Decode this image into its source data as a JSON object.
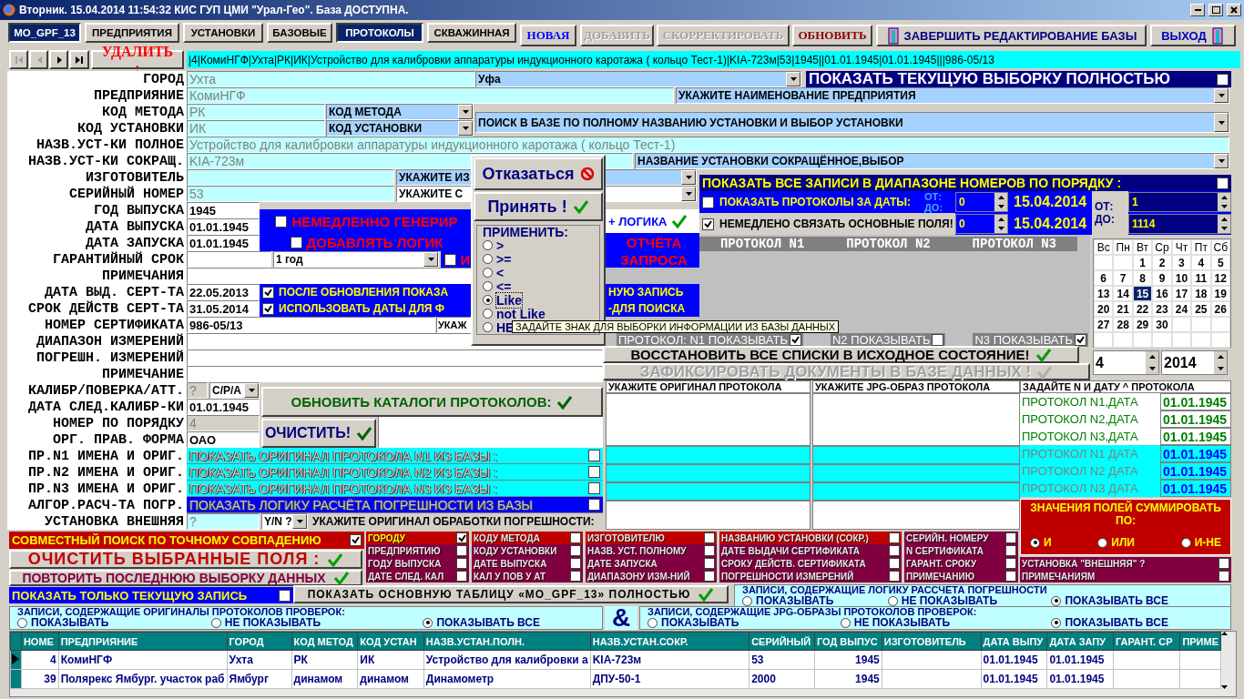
{
  "window": {
    "title": "Вторник. 15.04.2014 11:54:32  КИС ГУП ЦМИ \"Урал-Гео\". База ДОСТУПНА."
  },
  "tabs": [
    {
      "label": "MO_GPF_13",
      "selected": true
    },
    {
      "label": "ПРЕДПРИЯТИЯ",
      "selected": false
    },
    {
      "label": "УСТАНОВКИ",
      "selected": false
    },
    {
      "label": "БАЗОВЫЕ",
      "selected": false
    },
    {
      "label": "ПРОТОКОЛЫ",
      "selected": true
    },
    {
      "label": "СКВАЖИННАЯ",
      "selected": false
    }
  ],
  "toolbar": [
    {
      "kind": "serif",
      "label": "НОВАЯ",
      "disabled": false,
      "color": "#0000ff"
    },
    {
      "kind": "serif",
      "label": "ДОБАВИТЬ",
      "disabled": true
    },
    {
      "kind": "serif",
      "label": "СКОРРЕКТИРОВАТЬ",
      "disabled": true
    },
    {
      "kind": "serif",
      "label": "ОБНОВИТЬ",
      "disabled": false,
      "color": "#8b0000"
    },
    {
      "kind": "door",
      "label": "ЗАВЕРШИТЬ РЕДАКТИРОВАНИЕ БАЗЫ",
      "disabled": false,
      "color": "#000080"
    },
    {
      "kind": "door",
      "label": "ВЫХОД",
      "disabled": false,
      "color": "#0000c0"
    }
  ],
  "nav": {
    "buttons": [
      {
        "kind": "first",
        "disabled": true
      },
      {
        "kind": "prev",
        "disabled": true
      },
      {
        "kind": "next",
        "disabled": false
      },
      {
        "kind": "last",
        "disabled": false
      }
    ],
    "delete_label": "УДАЛИТЬ :",
    "record": "|4|КомиНГФ|Ухта|РК|ИК|Устройство для калибровки аппаратуры индукционного каротажа ( кольцо Тест-1)|KIA-723м|53|1945||01.01.1945|01.01.1945|||986-05/13"
  },
  "labels": [
    "ГОРОД",
    "ПРЕДПРИЯНИЕ",
    "КОД МЕТОДА",
    "КОД УСТАНОВКИ",
    "НАЗВ.УСТ-КИ ПОЛНОЕ",
    "НАЗВ.УСТ-КИ СОКРАЩ.",
    "ИЗГОТОВИТЕЛЬ",
    "СЕРИЙНЫЙ НОМЕР",
    "ГОД ВЫПУСКА",
    "ДАТА ВЫПУСКА",
    "ДАТА ЗАПУСКА",
    "ГАРАНТИЙНЫЙ СРОК",
    "ПРИМЕЧАНИЯ",
    "ДАТА ВЫД. СЕРТ-ТА",
    "СРОК ДЕЙСТВ СЕРТ-ТА",
    "НОМЕР СЕРТИФИКАТА",
    "ДИАПАЗОН ИЗМЕРЕНИЙ",
    "ПОГРЕШН. ИЗМЕРЕНИЙ",
    "ПРИМЕЧАНИЕ",
    "КАЛИБР/ПОВЕРКА/АТТ.",
    "ДАТА СЛЕД.КАЛИБР-КИ",
    "НОМЕР ПО ПОРЯДКУ",
    "ОРГ. ПРАВ. ФОРМА",
    "ПР.N1 ИМЕНА И ОРИГ.",
    "ПР.N2 ИМЕНА И ОРИГ.",
    "ПР.N3 ИМЕНА И ОРИГ.",
    "АЛГОР.РАСЧ-ТА ПОГР.",
    "УСТАНОВКА ВНЕШНЯЯ"
  ],
  "fields": [
    {
      "kind": "field",
      "value": "Ухта",
      "color": "#c0ffff",
      "disabled": true
    },
    {
      "kind": "combo",
      "value": "Уфа",
      "color": "#a6d2ff"
    },
    {
      "kind": "field",
      "value": "КомиНГФ",
      "color": "#c0ffff",
      "disabled": true
    },
    {
      "kind": "combo",
      "value": "УКАЖИТЕ НАИМЕНОВАНИЕ ПРЕДПРИЯТИЯ",
      "color": "#a6d2ff"
    },
    {
      "kind": "field",
      "value": "РК",
      "color": "#c0ffff",
      "disabled": true
    },
    {
      "kind": "combo",
      "value": "КОД МЕТОДА",
      "color": "#a6d2ff"
    },
    {
      "kind": "field",
      "value": "ИК",
      "color": "#c0ffff",
      "disabled": true
    },
    {
      "kind": "combo",
      "value": "КОД УСТАНОВКИ",
      "color": "#a6d2ff"
    },
    {
      "kind": "combo",
      "value": "ПОИСК В БАЗЕ ПО ПОЛНОМУ НАЗВАНИЮ УСТАНОВКИ И ВЫБОР УСТАНОВКИ",
      "color": "#a6d2ff"
    },
    {
      "kind": "field",
      "value": "Устройство для калибровки аппаратуры индукционного каротажа ( кольцо Тест-1)",
      "color": "#c0ffff",
      "disabled": true
    },
    {
      "kind": "field",
      "value": "KIA-723м",
      "color": "#c0ffff",
      "disabled": true
    },
    {
      "kind": "combo",
      "value": "НАЗВАНИЕ УСТАНОВКИ СОКРАЩЁННОЕ,ВЫБОР",
      "color": "#a6d2ff"
    },
    {
      "kind": "field",
      "color": "#c0ffff"
    },
    {
      "kind": "combo",
      "value": "УКАЖИТЕ ИЗ",
      "color": "#a6d2ff"
    },
    {
      "kind": "field",
      "value": "53",
      "color": "#c0ffff",
      "disabled": true
    },
    {
      "kind": "combo",
      "value": "УКАЖИТЕ С",
      "color": "#ffffff"
    },
    {
      "kind": "field",
      "value": "1945",
      "color": "#ffffff"
    },
    {
      "kind": "field",
      "value": "01.01.1945",
      "color": "#ffffff"
    },
    {
      "kind": "field",
      "value": "01.01.1945",
      "color": "#ffffff"
    },
    {
      "kind": "field",
      "color": "#ffffff"
    },
    {
      "kind": "combo",
      "value": "1 год",
      "color": "#ffffff"
    },
    {
      "kind": "field",
      "color": "#ffffff"
    },
    {
      "kind": "field",
      "value": "22.05.2013",
      "color": "#ffffff"
    },
    {
      "kind": "field",
      "value": "31.05.2014",
      "color": "#ffffff"
    },
    {
      "kind": "field",
      "value": "986-05/13",
      "color": "#ffffff"
    },
    {
      "kind": "field",
      "value": "УКАЖ",
      "color": "#ffffff"
    },
    {
      "kind": "field",
      "color": "#ffffff"
    },
    {
      "kind": "field",
      "color": "#ffffff"
    },
    {
      "kind": "field",
      "color": "#ffffff"
    },
    {
      "kind": "field",
      "value": "?",
      "color": "#d4d0c8",
      "disabled": true
    },
    {
      "kind": "combo",
      "value": "C/P/A",
      "color": "#ffffff"
    },
    {
      "kind": "field",
      "value": "01.01.1945",
      "color": "#ffffff"
    },
    {
      "kind": "field",
      "value": "4",
      "color": "#d4d0c8",
      "disabled": true
    },
    {
      "kind": "field",
      "value": "ОАО",
      "color": "#ffffff"
    },
    {
      "kind": "field",
      "value": "?",
      "color": "#c0ffff",
      "disabled": true
    },
    {
      "kind": "combo",
      "value": "Y/N ?",
      "color": "#ffffff"
    },
    {
      "kind": "field",
      "color": "#ffffff"
    }
  ],
  "notices": [
    {
      "kind": "alert",
      "text": "НЕМЕДЛЕННО ГЕНЕРИР",
      "checked": false
    },
    {
      "kind": "alert",
      "text": "ДОБАВЛЯТЬ ЛОГИК",
      "checked": false
    },
    {
      "kind": "alert",
      "text": "И",
      "checked": false
    },
    {
      "kind": "link",
      "text": "+ ЛОГИКА"
    },
    {
      "kind": "alert",
      "text": "ОТЧЁТА"
    },
    {
      "kind": "alert",
      "text": "ЗАПРОСА"
    },
    {
      "kind": "option",
      "text": "ПОСЛЕ ОБНОВЛЕНИЯ ПОКАЗА",
      "checked": true
    },
    {
      "kind": "option",
      "text": "ИСПОЛЬЗОВАТЬ ДАТЫ ДЛЯ Ф",
      "checked": true
    },
    {
      "kind": "option",
      "text": "НУЮ ЗАПИСЬ"
    },
    {
      "kind": "option",
      "text": "-ДЛЯ ПОИСКА"
    }
  ],
  "bars": [
    {
      "kind": "headline",
      "text": "ПОКАЗАТЬ ТЕКУЩУЮ ВЫБОРКУ ПОЛНОСТЬЮ",
      "color": "#000080",
      "checked": false
    },
    {
      "kind": "banner",
      "text": "ПОКАЗАТЬ ВСЕ ЗАПИСИ В ДИАПАЗОНЕ НОМЕРОВ ПО ПОРЯДКУ :",
      "color": "#000080",
      "checked": false
    },
    {
      "kind": "outline",
      "text": "ПОКАЗАТЬ ОРИГИНАЛ ПРОТОКОЛА N1 ИЗ БАЗЫ :",
      "color": "#00ffff",
      "checked": false
    },
    {
      "kind": "outline",
      "text": "ПОКАЗАТЬ ОРИГИНАЛ ПРОТОКОЛА N2 ИЗ БАЗЫ :",
      "color": "#00ffff",
      "checked": false
    },
    {
      "kind": "outline",
      "text": "ПОКАЗАТЬ ОРИГИНАЛ ПРОТОКОЛА N3 ИЗ БАЗЫ :",
      "color": "#00ffff",
      "checked": false
    },
    {
      "kind": "outline",
      "text": "ПОКАЗАТЬ ЛОГИКУ РАСЧЁТА ПОГРЕШНОСТИ ИЗ БАЗЫ",
      "color": "#0000ff",
      "checked": false
    }
  ],
  "date_filter": {
    "by_dates": {
      "label": "ПОКАЗАТЬ ПРОТОКОЛЫ ЗА ДАТЫ:",
      "checked": false
    },
    "link_fields": {
      "label": "НЕМЕДЛЕНО СВЯЗАТЬ ОСНОВНЫЕ ПОЛЯ!",
      "checked": true
    },
    "from_label": "ОТ:",
    "to_label": "ДО:",
    "from_number": "0",
    "to_number": "0",
    "from_date": "15.04.2014",
    "to_date": "15.04.2014",
    "range_from_label": "ОТ:",
    "range_to_label": "ДО:",
    "range_from": "1",
    "range_to": "1114"
  },
  "protocol_headers": [
    "ПРОТОКОЛ N1",
    "ПРОТОКОЛ N2",
    "ПРОТОКОЛ N3"
  ],
  "protocol_toggles": [
    {
      "label": "ПРОТОКОЛ: N1 ПОКАЗЫВАТЬ",
      "checked": true
    },
    {
      "label": "N2 ПОКАЗЫВАТЬ",
      "checked": false
    },
    {
      "label": "N3 ПОКАЗЫВАТЬ",
      "checked": true
    }
  ],
  "actions": [
    {
      "label": "ВОССТАНОВИТЬ ВСЕ СПИСКИ В ИСХОДНОЕ СОСТОЯНИЕ!",
      "disabled": false
    },
    {
      "label": "ЗАФИКСИРОВАТЬ ДОКУМЕНТЫ В БАЗЕ ДАННЫХ !",
      "disabled": true
    },
    {
      "label": "ОБНОВИТЬ КАТАЛОГИ ПРОТОКОЛОВ:",
      "disabled": false
    },
    {
      "label": "ОЧИСТИТЬ!",
      "disabled": false
    }
  ],
  "calendar": {
    "weekdays": [
      "Вс",
      "Пн",
      "Вт",
      "Ср",
      "Чт",
      "Пт",
      "Сб"
    ],
    "weeks": [
      [
        {
          "day": "1",
          "selected": false
        },
        {
          "day": "2",
          "selected": false
        },
        {
          "day": "3",
          "selected": false
        },
        {
          "day": "4",
          "selected": false
        },
        {
          "day": "5",
          "selected": false
        }
      ],
      [
        {
          "day": "6",
          "selected": false
        },
        {
          "day": "7",
          "selected": false
        },
        {
          "day": "8",
          "selected": false
        },
        {
          "day": "9",
          "selected": false
        },
        {
          "day": "10",
          "selected": false
        },
        {
          "day": "11",
          "selected": false
        },
        {
          "day": "12",
          "selected": false
        }
      ],
      [
        {
          "day": "13",
          "selected": false
        },
        {
          "day": "14",
          "selected": false
        },
        {
          "day": "15",
          "selected": true
        },
        {
          "day": "16",
          "selected": false
        },
        {
          "day": "17",
          "selected": false
        },
        {
          "day": "18",
          "selected": false
        },
        {
          "day": "19",
          "selected": false
        }
      ],
      [
        {
          "day": "20",
          "selected": false
        },
        {
          "day": "21",
          "selected": false
        },
        {
          "day": "22",
          "selected": false
        },
        {
          "day": "23",
          "selected": false
        },
        {
          "day": "24",
          "selected": false
        },
        {
          "day": "25",
          "selected": false
        },
        {
          "day": "26",
          "selected": false
        }
      ],
      [
        {
          "day": "27",
          "selected": false
        },
        {
          "day": "28",
          "selected": false
        },
        {
          "day": "29",
          "selected": false
        },
        {
          "day": "30",
          "selected": false
        }
      ]
    ],
    "month": "4",
    "year": "2014"
  },
  "file_columns": [
    {
      "header": "УКАЖИТЕ ОРИГИНАЛ ПРОТОКОЛА"
    },
    {
      "header": "УКАЖИТЕ JPG-ОБРАЗ ПРОТОКОЛА"
    }
  ],
  "protocol_dates": {
    "header": "ЗАДАЙТЕ N И ДАТУ ^ ПРОТОКОЛА",
    "rows": [
      {
        "kind": "edit",
        "label": "ПРОТОКОЛ N1,ДАТА",
        "date": "01.01.1945"
      },
      {
        "kind": "edit",
        "label": "ПРОТОКОЛ N2,ДАТА",
        "date": "01.01.1945"
      },
      {
        "kind": "edit",
        "label": "ПРОТОКОЛ N3,ДАТА",
        "date": "01.01.1945"
      },
      {
        "kind": "view",
        "label": "ПРОТОКОЛ N1 ДАТА",
        "date": "01.01.1945"
      },
      {
        "kind": "view",
        "label": "ПРОТОКОЛ N2 ДАТА",
        "date": "01.01.1945"
      },
      {
        "kind": "view",
        "label": "ПРОТОКОЛ N3 ДАТА",
        "date": "01.01.1945"
      }
    ]
  },
  "error_source_label": "УКАЖИТЕ ОРИГИНАЛ ОБРАБОТКИ ПОГРЕШНОСТИ:",
  "sum_panel": {
    "title": "ЗНАЧЕНИЯ ПОЛЕЙ СУММИРОВАТЬ ПО:",
    "options": [
      {
        "label": "И",
        "selected": true
      },
      {
        "label": "ИЛИ",
        "selected": false
      },
      {
        "label": "И-НЕ",
        "selected": false
      }
    ]
  },
  "exact_search": {
    "label": "СОВМЕСТНЫЙ ПОИСК ПО ТОЧНОМУ СОВПАДЕНИЮ",
    "checked": true
  },
  "clear_fields": "ОЧИСТИТЬ ВЫБРАННЫЕ ПОЛЯ :",
  "repeat_last": "ПОВТОРИТЬ ПОСЛЕДНЮЮ ВЫБОРКУ ДАННЫХ",
  "current_only": {
    "label": "ПОКАЗАТЬ ТОЛЬКО ТЕКУЩУЮ ЗАПИСЬ",
    "checked": false
  },
  "show_table": "ПОКАЗАТЬ ОСНОВНУЮ ТАБЛИЦУ «MO_GPF_13» ПОЛНОСТЬЮ",
  "match_fields": [
    [
      {
        "label": "ГОРОДУ",
        "checked": true,
        "color": "#c00000"
      },
      {
        "label": "ПРЕДПРИЯТИЮ",
        "checked": false,
        "color": "#800040"
      },
      {
        "label": "ГОДУ ВЫПУСКА",
        "checked": false,
        "color": "#800040"
      },
      {
        "label": "ДАТЕ СЛЕД. КАЛ",
        "checked": false,
        "color": "#800040"
      }
    ],
    [
      {
        "label": "КОДУ МЕТОДА",
        "checked": false,
        "color": "#c00000"
      },
      {
        "label": "КОДУ УСТАНОВКИ",
        "checked": false,
        "color": "#800040"
      },
      {
        "label": "ДАТЕ ВЫПУСКА",
        "checked": false,
        "color": "#800040"
      },
      {
        "label": "КАЛ У ПОВ У АТ",
        "checked": false,
        "color": "#800040"
      }
    ],
    [
      {
        "label": "ИЗГОТОВИТЕЛЮ",
        "checked": false,
        "color": "#c00000"
      },
      {
        "label": "НАЗВ. УСТ. ПОЛНОМУ",
        "checked": false,
        "color": "#800040"
      },
      {
        "label": "ДАТЕ ЗАПУСКА",
        "checked": false,
        "color": "#800040"
      },
      {
        "label": "ДИАПАЗОНУ ИЗМ-НИЙ",
        "checked": false,
        "color": "#800040"
      }
    ],
    [
      {
        "label": "НАЗВАНИЮ УСТАНОВКИ (СОКР.)",
        "checked": false,
        "color": "#c00000"
      },
      {
        "label": "ДАТЕ ВЫДАЧИ СЕРТИФИКАТА",
        "checked": false,
        "color": "#800040"
      },
      {
        "label": "СРОКУ ДЕЙСТВ. СЕРТИФИКАТА",
        "checked": false,
        "color": "#800040"
      },
      {
        "label": "ПОГРЕШНОСТИ ИЗМЕРЕНИЙ",
        "checked": false,
        "color": "#800040"
      }
    ],
    [
      {
        "label": "СЕРИЙН. НОМЕРУ",
        "checked": false,
        "color": "#800040"
      },
      {
        "label": "N СЕРТИФИКАТА",
        "checked": false,
        "color": "#800040"
      },
      {
        "label": "ГАРАНТ. СРОКУ",
        "checked": false,
        "color": "#800040"
      },
      {
        "label": "ПРИМЕЧАНИЮ",
        "checked": false,
        "color": "#800040"
      }
    ],
    [
      {
        "label": "УСТАНОВКА \"ВНЕШНЯЯ\" ?",
        "checked": false,
        "color": "#800040"
      },
      {
        "label": "ПРИМЕЧАНИЯМ",
        "checked": false,
        "color": "#800040"
      }
    ]
  ],
  "filters": [
    {
      "title": "ЗАПИСИ, СОДЕРЖАЩИЕ ЛОГИКУ  РАССЧЁТА ПОГРЕШНОСТИ",
      "options": [
        {
          "label": "ПОКАЗЫВАТЬ",
          "selected": false
        },
        {
          "label": "НЕ ПОКАЗЫВАТЬ",
          "selected": false
        },
        {
          "label": "ПОКАЗЫВАТЬ ВСЕ",
          "selected": true
        }
      ]
    },
    {
      "title": "ЗАПИСИ, СОДЕРЖАЩИЕ ОРИГИНАЛЫ ПРОТОКОЛОВ ПРОВЕРОК:",
      "options": [
        {
          "label": "ПОКАЗЫВАТЬ",
          "selected": false
        },
        {
          "label": "НЕ ПОКАЗЫВАТЬ",
          "selected": false
        },
        {
          "label": "ПОКАЗЫВАТЬ ВСЕ",
          "selected": true
        }
      ]
    },
    {
      "title": "ЗАПИСИ, СОДЕРЖАЩИЕ JPG-ОБРАЗЫ ПРОТОКОЛОВ ПРОВЕРОК:",
      "options": [
        {
          "label": "ПОКАЗЫВАТЬ",
          "selected": false
        },
        {
          "label": "НЕ ПОКАЗЫВАТЬ",
          "selected": false
        },
        {
          "label": "ПОКАЗЫВАТЬ ВСЕ",
          "selected": true
        }
      ]
    }
  ],
  "ampersand": "&",
  "table": {
    "columns": [
      "НОМЕ",
      "ПРЕДПРИЯНИЕ",
      "ГОРОД",
      "КОД МЕТОД",
      "КОД УСТАН",
      "НАЗВ.УСТАН.ПОЛН.",
      "НАЗВ.УСТАН.СОКР.",
      "СЕРИЙНЫЙ",
      "ГОД ВЫПУС",
      "ИЗГОТОВИТЕЛЬ",
      "ДАТА ВЫПУ",
      "ДАТА ЗАПУ",
      "ГАРАНТ. СР",
      "ПРИМЕ"
    ],
    "rows": [
      {
        "selected": true,
        "cells": [
          "4",
          "КомиНГФ",
          "Ухта",
          "РК",
          "ИК",
          "Устройство для калибровки а",
          "KIA-723м",
          "53",
          "1945",
          null,
          "01.01.1945",
          "01.01.1945",
          null,
          null
        ]
      },
      {
        "selected": false,
        "cells": [
          "39",
          "Полярекс Ямбург. участок раб",
          "Ямбург",
          "динамом",
          "динамом",
          "Динамометр",
          "ДПУ-50-1",
          "2000",
          "1945",
          null,
          "01.01.1945",
          "01.01.1945",
          null,
          null
        ]
      }
    ]
  },
  "operator_popup": {
    "cancel": "Отказаться",
    "accept": "Принять !",
    "group_title": "ПРИМЕНИТЬ:",
    "options": [
      {
        "label": ">",
        "selected": false
      },
      {
        "label": ">=",
        "selected": false
      },
      {
        "label": "<",
        "selected": false
      },
      {
        "label": "<=",
        "selected": false
      },
      {
        "label": "Like",
        "selected": true
      },
      {
        "label": "not Like",
        "selected": false
      },
      {
        "label": "НЕ",
        "selected": false
      }
    ]
  },
  "tooltip": "ЗАДАЙТЕ ЗНАК ДЛЯ ВЫБОРКИ ИНФОРМАЦИИ ИЗ БАЗЫ ДАННЫХ"
}
